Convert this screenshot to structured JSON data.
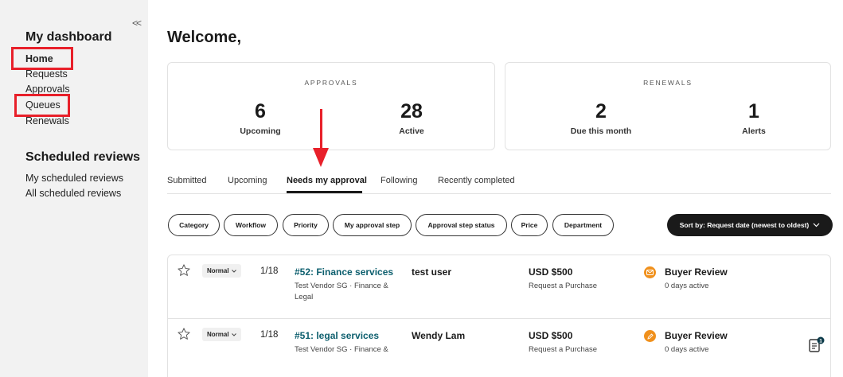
{
  "sidebar": {
    "collapse_icon": "double-chevron-left-icon",
    "dashboard_heading": "My dashboard",
    "nav_items": [
      {
        "label": "Home",
        "active": true
      },
      {
        "label": "Requests",
        "active": false
      },
      {
        "label": "Approvals",
        "active": false
      },
      {
        "label": "Queues",
        "active": false
      },
      {
        "label": "Renewals",
        "active": false
      }
    ],
    "scheduled_heading": "Scheduled reviews",
    "scheduled_items": [
      {
        "label": "My scheduled reviews"
      },
      {
        "label": "All scheduled reviews"
      }
    ]
  },
  "main": {
    "welcome": "Welcome,",
    "approvals_card": {
      "title": "APPROVALS",
      "stats": [
        {
          "value": "6",
          "label": "Upcoming"
        },
        {
          "value": "28",
          "label": "Active"
        }
      ]
    },
    "renewals_card": {
      "title": "RENEWALS",
      "stats": [
        {
          "value": "2",
          "label": "Due this month"
        },
        {
          "value": "1",
          "label": "Alerts"
        }
      ]
    },
    "tabs": [
      {
        "label": "Submitted",
        "active": false
      },
      {
        "label": "Upcoming",
        "active": false
      },
      {
        "label": "Needs my approval",
        "active": true
      },
      {
        "label": "Following",
        "active": false
      },
      {
        "label": "Recently completed",
        "active": false
      }
    ],
    "filters": [
      "Category",
      "Workflow",
      "Priority",
      "My approval step",
      "Approval step status",
      "Price",
      "Department"
    ],
    "sort": {
      "label": "Sort by: Request date (newest to oldest)",
      "icon": "chevron-down-icon"
    },
    "rows": [
      {
        "priority": "Normal",
        "step": "1/18",
        "title": "#52: Finance services",
        "subtitle": "Test Vendor SG · Finance & Legal",
        "requester": "test user",
        "amount": "USD $500",
        "amount_sub": "Request a Purchase",
        "status": "Buyer Review",
        "status_sub": "0 days active",
        "status_icon": "envelope-icon"
      },
      {
        "priority": "Normal",
        "step": "1/18",
        "title": "#51: legal services",
        "subtitle": "Test Vendor SG · Finance &",
        "requester": "Wendy Lam",
        "amount": "USD $500",
        "amount_sub": "Request a Purchase",
        "status": "Buyer Review",
        "status_sub": "0 days active",
        "status_icon": "pencil-icon"
      }
    ],
    "notes_badge": "1"
  },
  "colors": {
    "annotation_red": "#e8202a",
    "link_teal": "#0d5f6e",
    "status_orange": "#f0901c",
    "sidebar_bg": "#f2f2f2"
  }
}
